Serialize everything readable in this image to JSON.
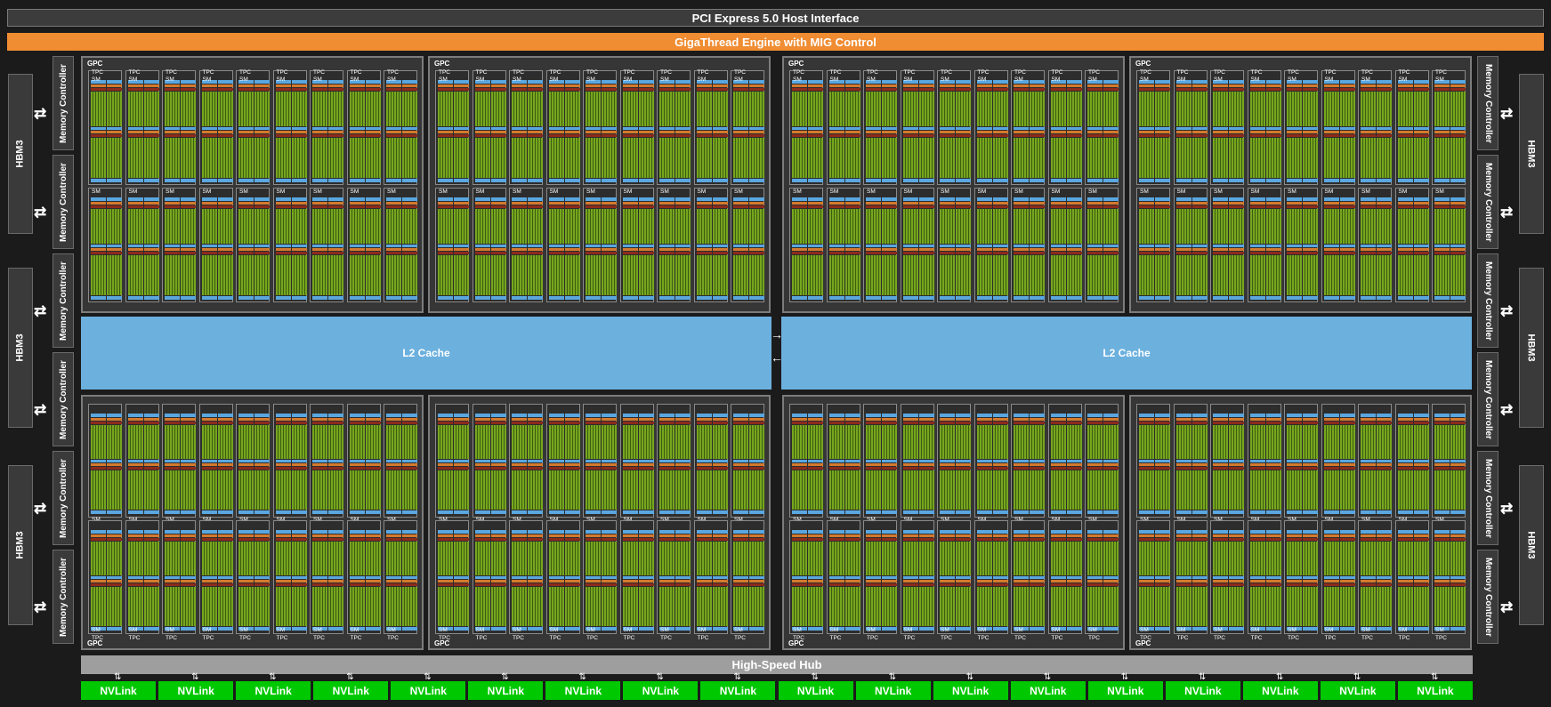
{
  "header": {
    "pcie_label": "PCI Express 5.0 Host Interface",
    "gigathread_label": "GigaThread Engine with MIG Control"
  },
  "memory": {
    "hbm_label": "HBM3",
    "controller_label": "Memory Controller"
  },
  "l2": {
    "label": "L2 Cache"
  },
  "gpc": {
    "label": "GPC",
    "tpc_label": "TPC",
    "sm_label": "SM"
  },
  "hub": {
    "label": "High-Speed Hub"
  },
  "nvlink": {
    "label": "NVLink",
    "count": 18
  },
  "colors": {
    "background": "#1b1b1b",
    "gigathread": "#f08c32",
    "l2": "#6cb0de",
    "core": "#76a61e",
    "nvlink": "#00c800",
    "hub": "#9e9e9e"
  }
}
